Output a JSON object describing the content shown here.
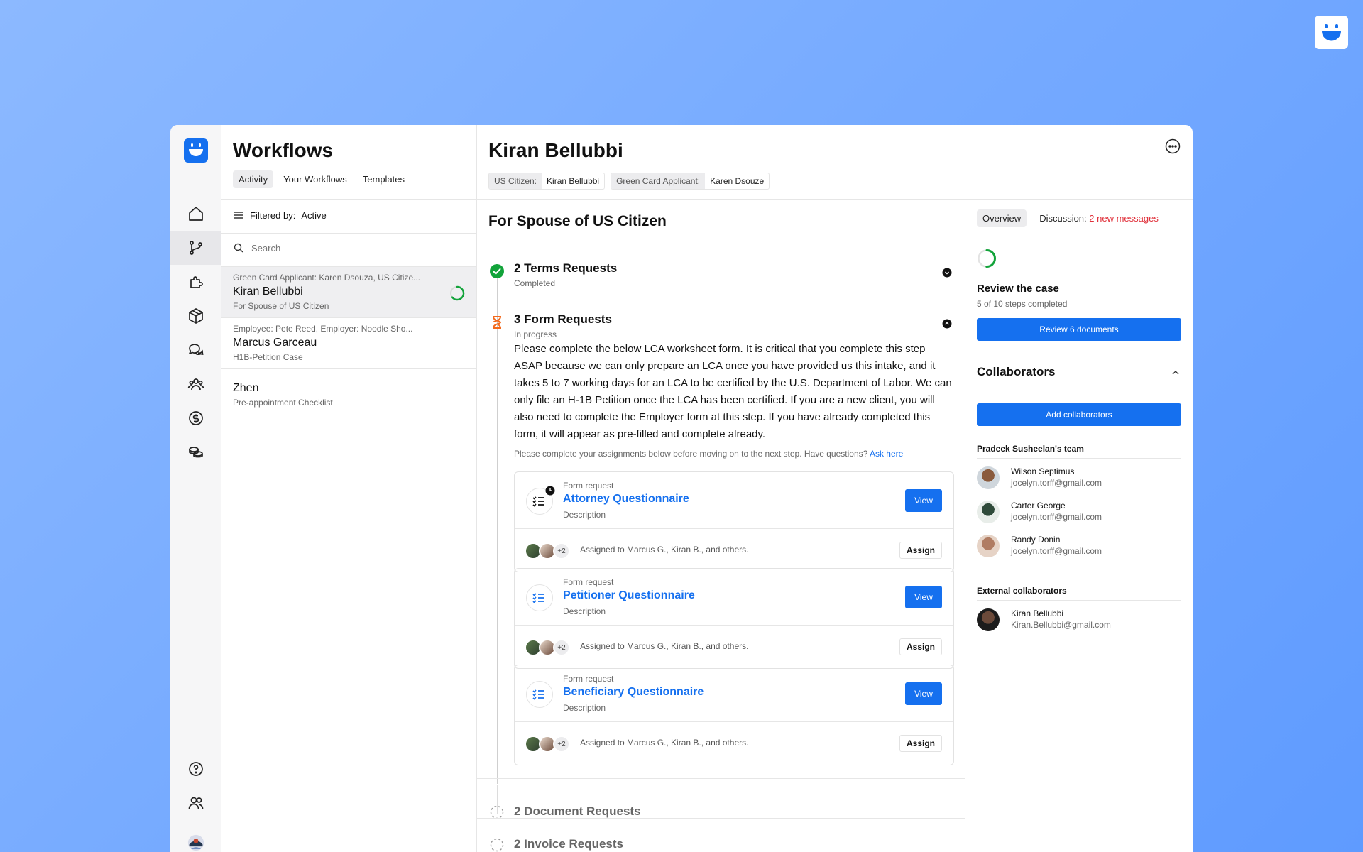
{
  "sidebar": {
    "nav": [
      "home",
      "workflows",
      "integrations",
      "packages",
      "messages",
      "contacts",
      "billing",
      "payments"
    ],
    "bottom": [
      "help",
      "team",
      "profile"
    ]
  },
  "workflows": {
    "title": "Workflows",
    "tabs": [
      "Activity",
      "Your Workflows",
      "Templates"
    ],
    "active_tab": "Activity",
    "filter_label": "Filtered by:",
    "filter_value": "Active",
    "search_placeholder": "Search",
    "items": [
      {
        "meta": "Green Card Applicant: Karen Dsouza, US Citize...",
        "name": "Kiran Bellubbi",
        "sub": "For Spouse of US Citizen"
      },
      {
        "meta": "Employee: Pete Reed, Employer: Noodle Sho...",
        "name": "Marcus Garceau",
        "sub": "H1B-Petition Case"
      },
      {
        "meta": "",
        "name": "Zhen",
        "sub": "Pre-appointment Checklist"
      }
    ]
  },
  "detail": {
    "title": "Kiran Bellubbi",
    "chips": [
      {
        "key": "US Citizen:",
        "value": "Kiran Bellubbi"
      },
      {
        "key": "Green Card Applicant:",
        "value": "Karen Dsouze"
      }
    ],
    "section_title": "For Spouse of US Citizen",
    "steps": [
      {
        "title": "2 Terms Requests",
        "status": "Completed"
      },
      {
        "title": "3 Form Requests",
        "status": "In progress"
      },
      {
        "title": "2 Document Requests",
        "status": ""
      },
      {
        "title": "2 Invoice Requests",
        "status": ""
      }
    ],
    "instructions": "Please complete the below LCA worksheet form. It is critical that you complete this step ASAP because we can only prepare an LCA once you have provided us this intake, and it takes 5 to 7 working days for an LCA to be certified by the U.S. Department of Labor. We can only file an H-1B Petition once the LCA has been certified. If you are a new client, you will also need to complete the Employer form at this step. If you have already completed this form, it will appear as pre-filled and complete already.",
    "hint": "Please complete your assignments below before moving on to the next step. Have questions?",
    "hint_link": "Ask here",
    "forms": [
      {
        "kind": "Form request",
        "name": "Attorney Questionnaire",
        "desc": "Description",
        "more": "+2",
        "assigned": "Assigned to Marcus G., Kiran B., and others.",
        "view": "View",
        "assign": "Assign"
      },
      {
        "kind": "Form request",
        "name": "Petitioner Questionnaire",
        "desc": "Description",
        "more": "+2",
        "assigned": "Assigned to Marcus G., Kiran B., and others.",
        "view": "View",
        "assign": "Assign"
      },
      {
        "kind": "Form request",
        "name": "Beneficiary Questionnaire",
        "desc": "Description",
        "more": "+2",
        "assigned": "Assigned to Marcus G., Kiran B., and others.",
        "view": "View",
        "assign": "Assign"
      }
    ]
  },
  "side": {
    "tab_overview": "Overview",
    "tab_discussion": "Discussion:",
    "new_messages": "2 new messages",
    "progress_fraction": 0.5,
    "review_title": "Review the case",
    "review_sub": "5 of 10 steps completed",
    "review_button": "Review 6 documents",
    "collab_title": "Collaborators",
    "add_button": "Add collaborators",
    "team_title": "Pradeek Susheelan's team",
    "team": [
      {
        "name": "Wilson Septimus",
        "email": "jocelyn.torff@gmail.com"
      },
      {
        "name": "Carter George",
        "email": "jocelyn.torff@gmail.com"
      },
      {
        "name": "Randy Donin",
        "email": "jocelyn.torff@gmail.com"
      }
    ],
    "external_title": "External collaborators",
    "external": [
      {
        "name": "Kiran Bellubbi",
        "email": "Kiran.Bellubbi@gmail.com"
      }
    ]
  },
  "colors": {
    "accent": "#1570ef",
    "success": "#12a33a",
    "warning": "#f36a1d",
    "alert": "#e0303a"
  }
}
